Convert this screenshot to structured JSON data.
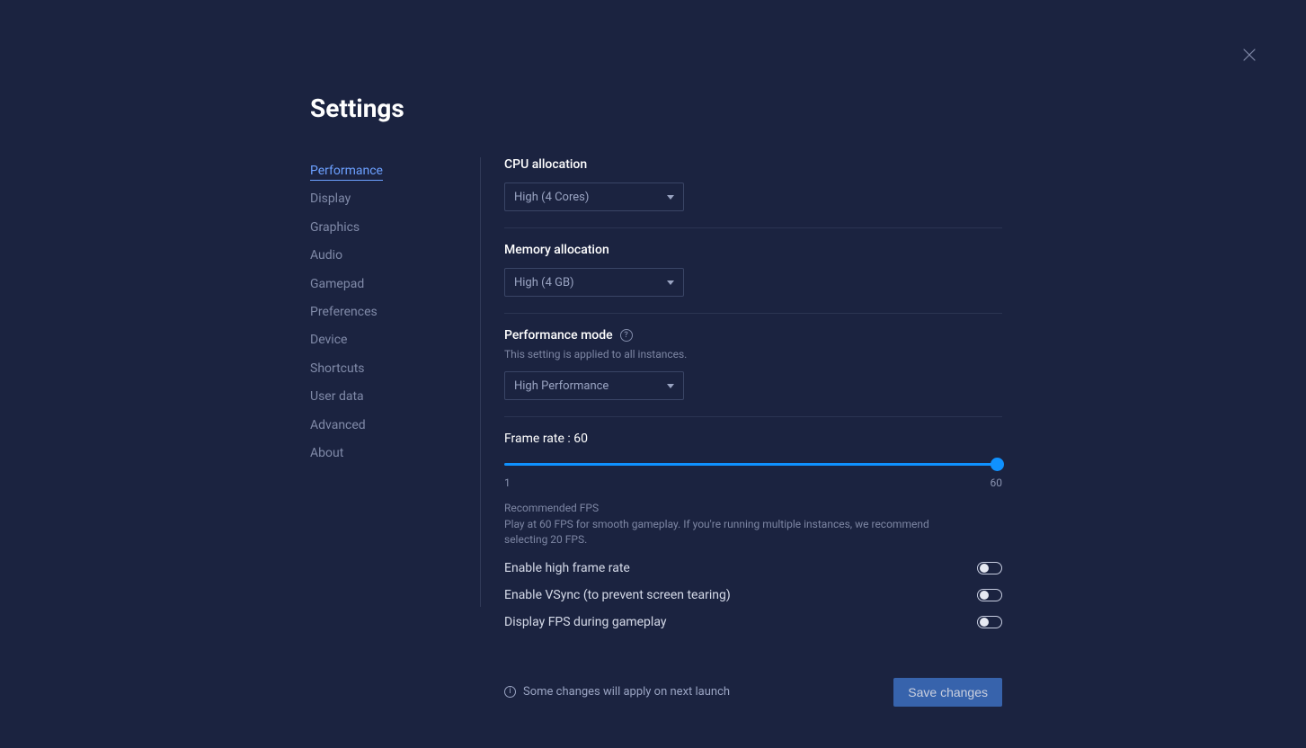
{
  "title": "Settings",
  "sidebar": {
    "items": [
      {
        "label": "Performance",
        "active": true
      },
      {
        "label": "Display",
        "active": false
      },
      {
        "label": "Graphics",
        "active": false
      },
      {
        "label": "Audio",
        "active": false
      },
      {
        "label": "Gamepad",
        "active": false
      },
      {
        "label": "Preferences",
        "active": false
      },
      {
        "label": "Device",
        "active": false
      },
      {
        "label": "Shortcuts",
        "active": false
      },
      {
        "label": "User data",
        "active": false
      },
      {
        "label": "Advanced",
        "active": false
      },
      {
        "label": "About",
        "active": false
      }
    ]
  },
  "cpu": {
    "label": "CPU allocation",
    "value": "High (4 Cores)"
  },
  "memory": {
    "label": "Memory allocation",
    "value": "High (4 GB)"
  },
  "perfmode": {
    "label": "Performance mode",
    "sub": "This setting is applied to all instances.",
    "value": "High Performance"
  },
  "framerate": {
    "label": "Frame rate : 60",
    "min": "1",
    "max": "60",
    "value": 60,
    "rec_title": "Recommended FPS",
    "rec_body": "Play at 60 FPS for smooth gameplay. If you're running multiple instances, we recommend selecting 20 FPS."
  },
  "toggles": {
    "high_fps": {
      "label": "Enable high frame rate",
      "on": false
    },
    "vsync": {
      "label": "Enable VSync (to prevent screen tearing)",
      "on": false
    },
    "display_fps": {
      "label": "Display FPS during gameplay",
      "on": false
    }
  },
  "footer": {
    "note": "Some changes will apply on next launch",
    "save": "Save changes"
  }
}
